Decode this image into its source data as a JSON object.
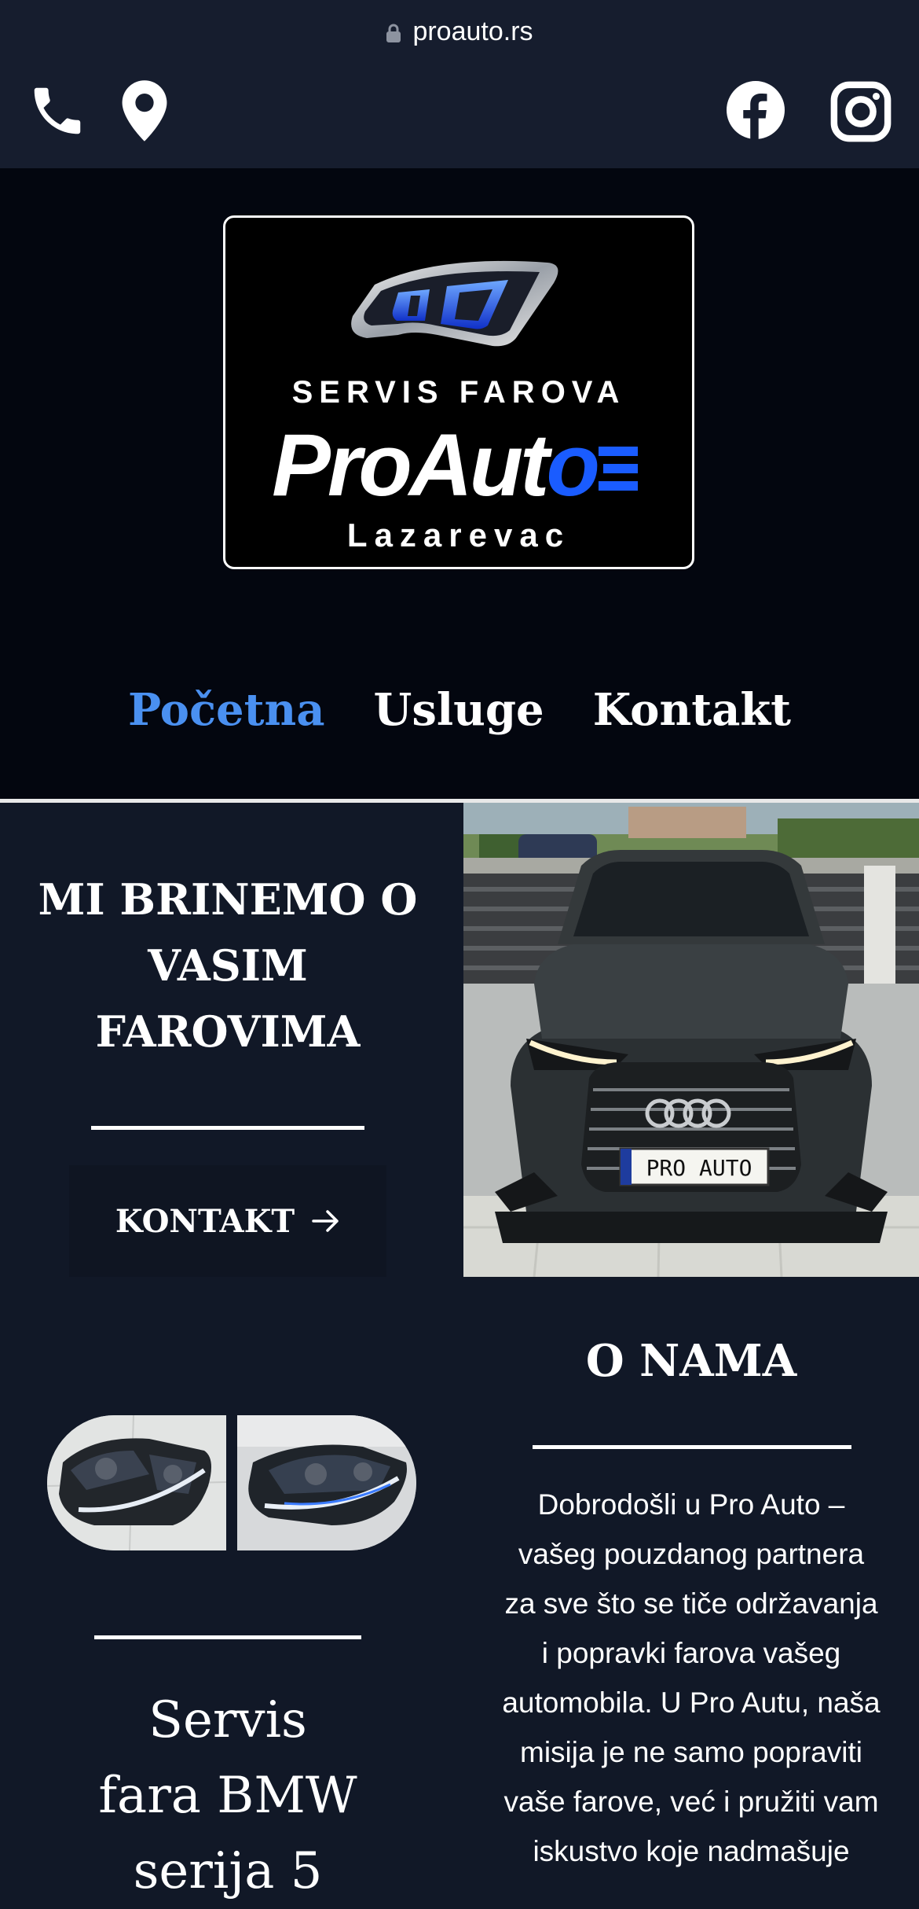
{
  "browser": {
    "url": "proauto.rs"
  },
  "topbar": {
    "icons": [
      "phone-icon",
      "map-pin-icon",
      "facebook-icon",
      "instagram-icon"
    ]
  },
  "logo": {
    "subtitle": "SERVIS FAROVA",
    "brand_main": "ProAut",
    "brand_o": "o",
    "city": "Lazarevac"
  },
  "nav": {
    "items": [
      {
        "label": "Početna",
        "active": true
      },
      {
        "label": "Usluge",
        "active": false
      },
      {
        "label": "Kontakt",
        "active": false
      }
    ]
  },
  "hero": {
    "title_line1": "MI BRINEMO O",
    "title_line2": "VASIM",
    "title_line3": "FAROVIMA",
    "button_label": "KONTAKT",
    "photo_plate": "PRO AUTO"
  },
  "service": {
    "title_line1": "Servis",
    "title_line2": "fara BMW",
    "title_line3": "serija 5"
  },
  "about": {
    "title": "O NAMA",
    "lines": [
      "Dobrodošli u Pro Auto –",
      "vašeg pouzdanog partnera",
      "za sve što se tiče održavanja",
      "i popravki farova vašeg",
      "automobila. U Pro Autu, naša",
      "misija je ne samo popraviti",
      "vaše farove, već i pružiti vam",
      "iskustvo koje nadmašuje"
    ]
  },
  "colors": {
    "accent": "#4a90f0",
    "header_bg": "#161d2e",
    "hero_bg": "#03060f",
    "body_bg": "#111827",
    "logo_blue": "#1a5cff"
  }
}
